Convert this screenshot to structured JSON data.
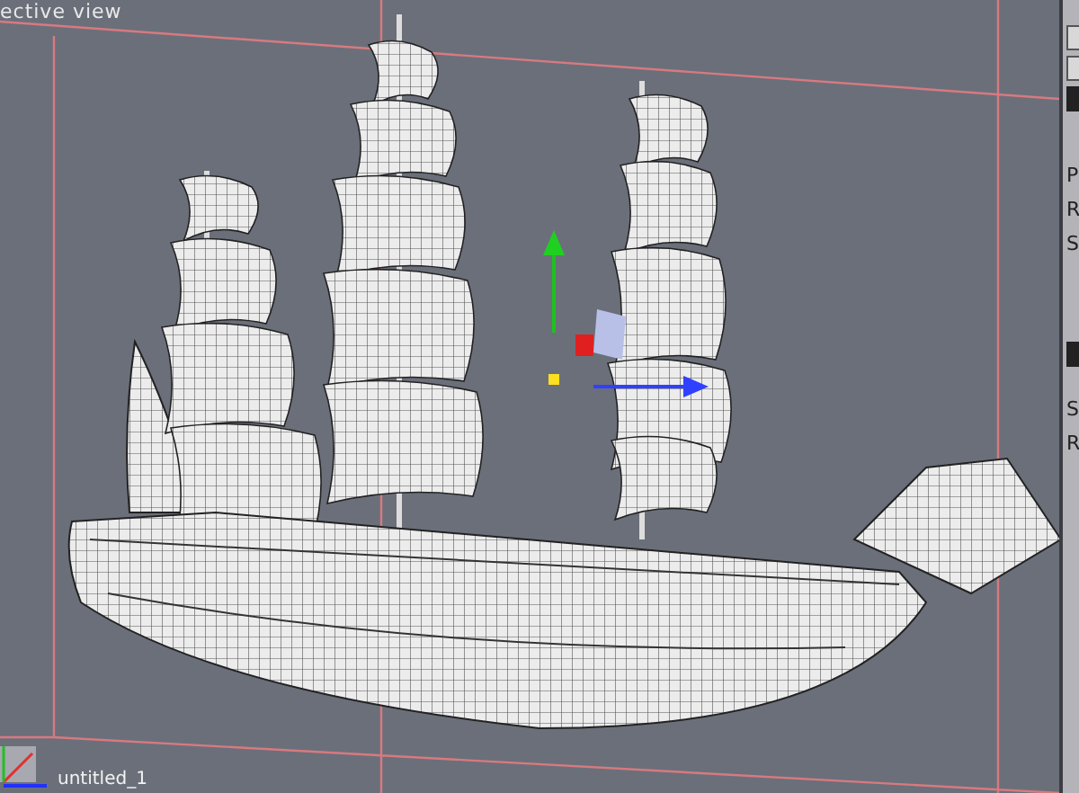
{
  "viewport": {
    "title": "ective view"
  },
  "side_panel": {
    "labels_top": [
      "P",
      "R",
      "S"
    ],
    "labels_bottom": [
      "S",
      "R"
    ]
  },
  "footer": {
    "document_name": "untitled_1"
  }
}
